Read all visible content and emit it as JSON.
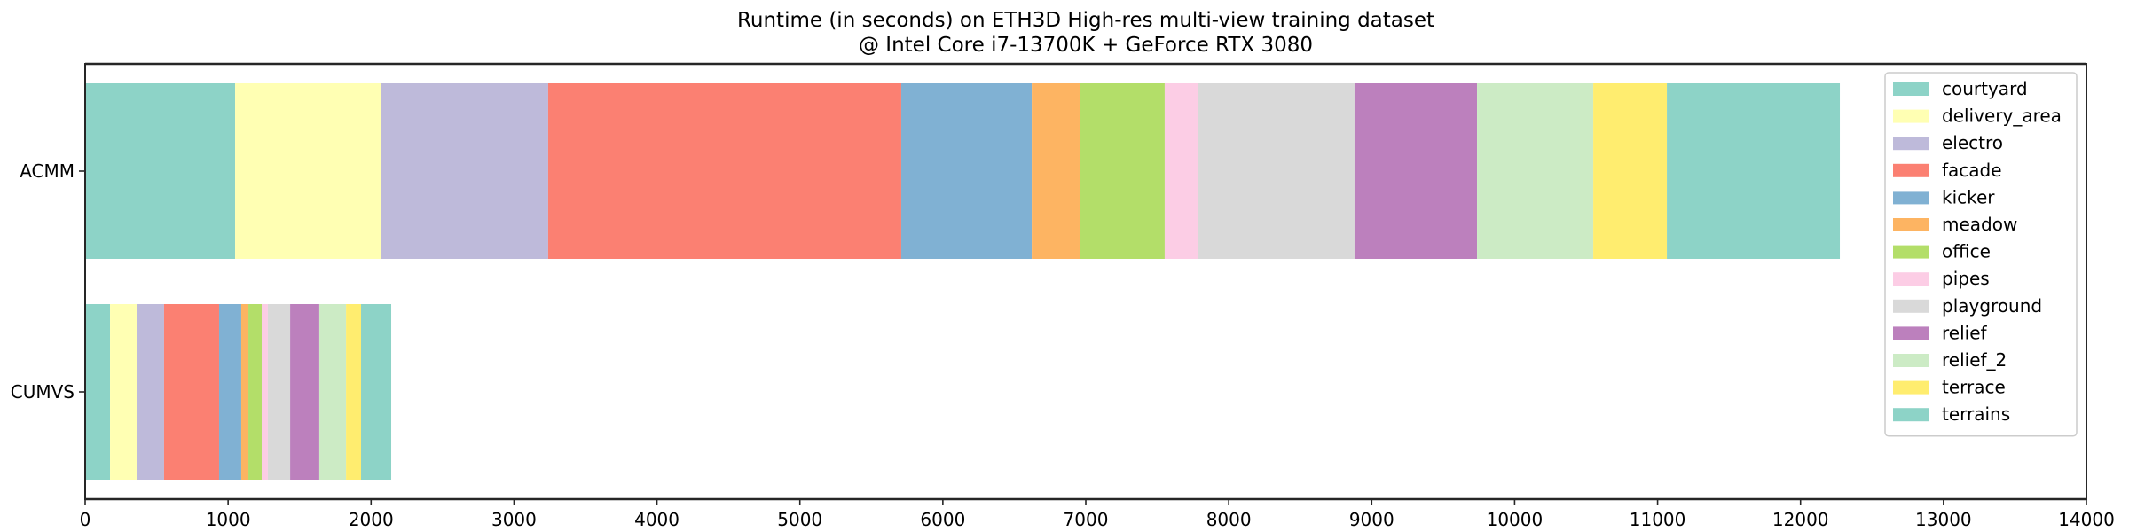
{
  "chart_data": {
    "type": "bar",
    "orientation": "horizontal",
    "stacked": true,
    "title": "Runtime (in seconds) on ETH3D High-res multi-view training dataset",
    "subtitle": "@ Intel Core i7-13700K + GeForce RTX 3080",
    "xlabel": "",
    "ylabel": "",
    "xlim": [
      0,
      14000
    ],
    "xticks": [
      0,
      1000,
      2000,
      3000,
      4000,
      5000,
      6000,
      7000,
      8000,
      9000,
      10000,
      11000,
      12000,
      13000,
      14000
    ],
    "xtick_labels": [
      "0",
      "1000",
      "2000",
      "3000",
      "4000",
      "5000",
      "6000",
      "7000",
      "8000",
      "9000",
      "10000",
      "11000",
      "12000",
      "13000",
      "14000"
    ],
    "categories": [
      "ACMM",
      "CUMVS"
    ],
    "grid": false,
    "legend_position": "top-right",
    "series": [
      {
        "name": "courtyard",
        "color": "#8dd3c7",
        "values": [
          1049,
          174
        ]
      },
      {
        "name": "delivery_area",
        "color": "#ffffb3",
        "values": [
          1018,
          192
        ]
      },
      {
        "name": "electro",
        "color": "#bebada",
        "values": [
          1172,
          186
        ]
      },
      {
        "name": "facade",
        "color": "#fb8072",
        "values": [
          2470,
          385
        ]
      },
      {
        "name": "kicker",
        "color": "#80b1d3",
        "values": [
          913,
          155
        ]
      },
      {
        "name": "meadow",
        "color": "#fdb462",
        "values": [
          335,
          50
        ]
      },
      {
        "name": "office",
        "color": "#b3de69",
        "values": [
          595,
          93
        ]
      },
      {
        "name": "pipes",
        "color": "#fccde5",
        "values": [
          230,
          43
        ]
      },
      {
        "name": "playground",
        "color": "#d9d9d9",
        "values": [
          1098,
          156
        ]
      },
      {
        "name": "relief",
        "color": "#bc80bd",
        "values": [
          857,
          204
        ]
      },
      {
        "name": "relief_2",
        "color": "#ccebc5",
        "values": [
          813,
          187
        ]
      },
      {
        "name": "terrace",
        "color": "#ffed6f",
        "values": [
          515,
          105
        ]
      },
      {
        "name": "terrains",
        "color": "#8dd3c7",
        "values": [
          1210,
          211
        ]
      }
    ]
  }
}
